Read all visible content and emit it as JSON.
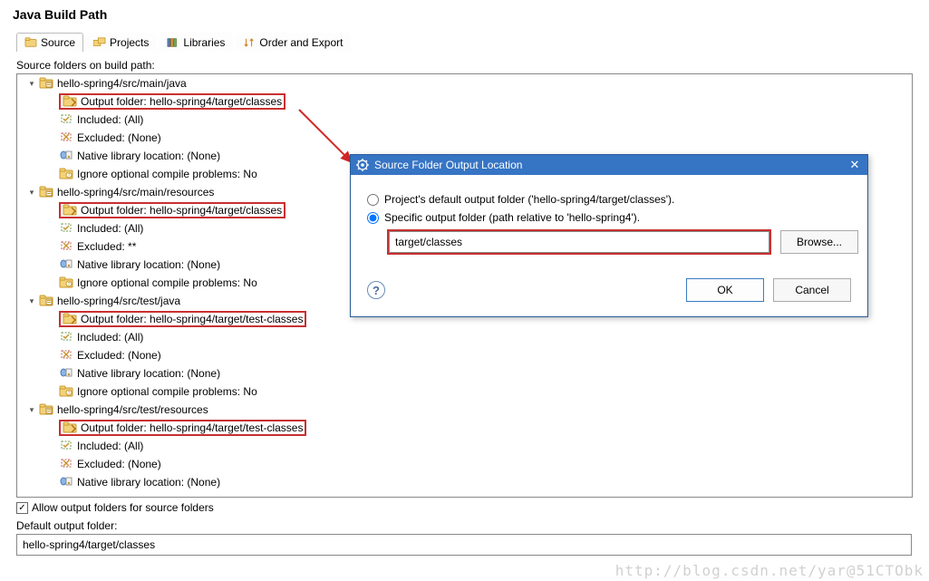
{
  "page": {
    "title": "Java Build Path",
    "subhead": "Source folders on build path:"
  },
  "tabs": [
    {
      "label": "Source",
      "icon": "source-icon"
    },
    {
      "label": "Projects",
      "icon": "projects-icon"
    },
    {
      "label": "Libraries",
      "icon": "libraries-icon"
    },
    {
      "label": "Order and Export",
      "icon": "order-icon"
    }
  ],
  "tree": [
    {
      "type": "folder",
      "label": "hello-spring4/src/main/java"
    },
    {
      "type": "output",
      "label": "Output folder: hello-spring4/target/classes",
      "highlight": true
    },
    {
      "type": "incl",
      "label": "Included: (All)"
    },
    {
      "type": "excl",
      "label": "Excluded: (None)"
    },
    {
      "type": "native",
      "label": "Native library location: (None)"
    },
    {
      "type": "opt",
      "label": "Ignore optional compile problems: No"
    },
    {
      "type": "folder",
      "label": "hello-spring4/src/main/resources"
    },
    {
      "type": "output",
      "label": "Output folder: hello-spring4/target/classes",
      "highlight": true
    },
    {
      "type": "incl",
      "label": "Included: (All)"
    },
    {
      "type": "excl",
      "label": "Excluded: **"
    },
    {
      "type": "native",
      "label": "Native library location: (None)"
    },
    {
      "type": "opt",
      "label": "Ignore optional compile problems: No"
    },
    {
      "type": "folder",
      "label": "hello-spring4/src/test/java"
    },
    {
      "type": "output",
      "label": "Output folder: hello-spring4/target/test-classes",
      "highlight": true
    },
    {
      "type": "incl",
      "label": "Included: (All)"
    },
    {
      "type": "excl",
      "label": "Excluded: (None)"
    },
    {
      "type": "native",
      "label": "Native library location: (None)"
    },
    {
      "type": "opt",
      "label": "Ignore optional compile problems: No"
    },
    {
      "type": "folder",
      "label": "hello-spring4/src/test/resources"
    },
    {
      "type": "output",
      "label": "Output folder: hello-spring4/target/test-classes",
      "highlight": true
    },
    {
      "type": "incl",
      "label": "Included: (All)"
    },
    {
      "type": "excl",
      "label": "Excluded: (None)"
    },
    {
      "type": "native",
      "label": "Native library location: (None)"
    }
  ],
  "allow_output": {
    "checked": true,
    "label": "Allow output folders for source folders"
  },
  "default_output": {
    "label": "Default output folder:",
    "value": "hello-spring4/target/classes"
  },
  "dialog": {
    "title": "Source Folder Output Location",
    "radio_default": {
      "label": "Project's default output folder ('hello-spring4/target/classes').",
      "checked": false
    },
    "radio_specific": {
      "label": "Specific output folder (path relative to 'hello-spring4').",
      "checked": true
    },
    "path_value": "target/classes",
    "browse": "Browse...",
    "ok": "OK",
    "cancel": "Cancel"
  },
  "watermark": "http://blog.csdn.net/yar@51CTObk"
}
